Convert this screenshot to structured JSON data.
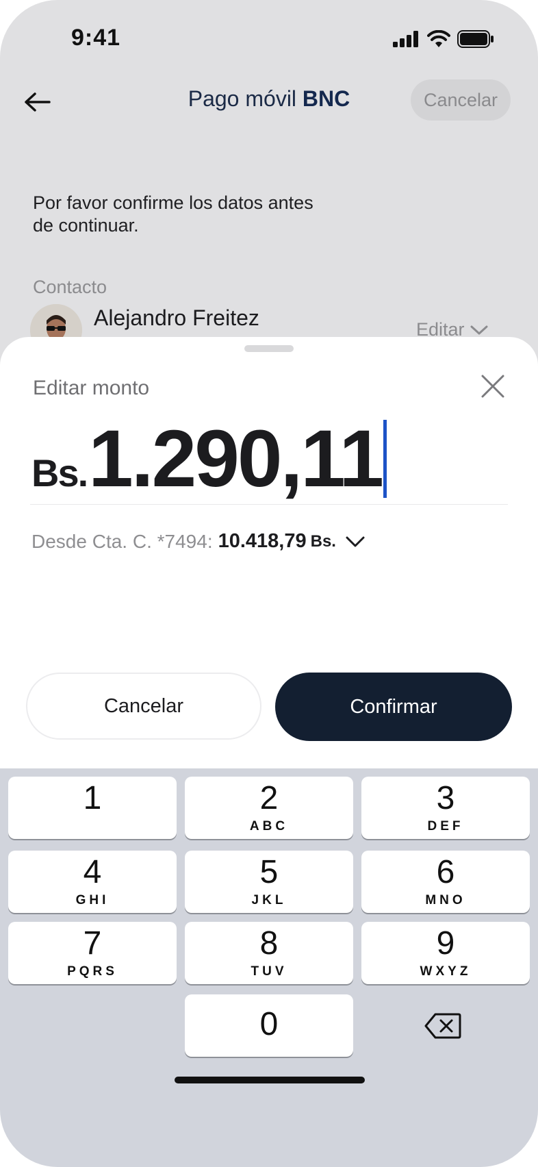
{
  "status": {
    "time": "9:41"
  },
  "header": {
    "title_main": "Pago móvil ",
    "title_brand": "BNC",
    "cancel_label": "Cancelar"
  },
  "confirm": {
    "message": "Por favor confirme los datos antes de continuar."
  },
  "contact": {
    "label": "Contacto",
    "name": "Alejandro Freitez",
    "edit_label": "Editar"
  },
  "sheet": {
    "title": "Editar monto",
    "currency": "Bs.",
    "amount": "1.290,11",
    "account_prefix": "Desde Cta. C. *7494:",
    "account_balance": "10.418,79",
    "account_currency": "Bs.",
    "cancel_label": "Cancelar",
    "confirm_label": "Confirmar"
  },
  "keyboard": {
    "keys": [
      {
        "num": "1",
        "letters": ""
      },
      {
        "num": "2",
        "letters": "ABC"
      },
      {
        "num": "3",
        "letters": "DEF"
      },
      {
        "num": "4",
        "letters": "GHI"
      },
      {
        "num": "5",
        "letters": "JKL"
      },
      {
        "num": "6",
        "letters": "MNO"
      },
      {
        "num": "7",
        "letters": "PQRS"
      },
      {
        "num": "8",
        "letters": "TUV"
      },
      {
        "num": "9",
        "letters": "WXYZ"
      },
      {
        "num": "0",
        "letters": ""
      }
    ]
  },
  "colors": {
    "accent": "#131f31",
    "brand": "#14284e",
    "cursor": "#1d53c7"
  }
}
